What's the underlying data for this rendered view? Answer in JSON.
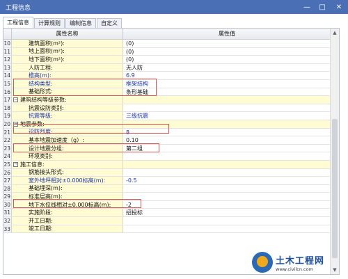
{
  "window": {
    "title": "工程信息",
    "minimize": "—",
    "maximize": "□",
    "close": "✕"
  },
  "tabs": [
    {
      "label": "工程信息"
    },
    {
      "label": "计算规则"
    },
    {
      "label": "编制信息"
    },
    {
      "label": "自定义"
    }
  ],
  "table": {
    "headers": {
      "name": "属性名称",
      "value": "属性值"
    },
    "rows": [
      {
        "num": "10",
        "name": "建筑面积(m²):",
        "value": "(0)"
      },
      {
        "num": "11",
        "name": "地上面积(m²):",
        "value": "(0)"
      },
      {
        "num": "12",
        "name": "地下面积(m²):",
        "value": "(0)"
      },
      {
        "num": "13",
        "name": "人防工程:",
        "value": "无人防"
      },
      {
        "num": "14",
        "name": "檐高(m):",
        "value": "6.9"
      },
      {
        "num": "15",
        "name": "结构类型:",
        "value": "框架结构"
      },
      {
        "num": "16",
        "name": "基础形式:",
        "value": "条形基础"
      },
      {
        "num": "17",
        "name": "建筑结构等级参数:",
        "value": ""
      },
      {
        "num": "18",
        "name": "抗震设防类别:",
        "value": ""
      },
      {
        "num": "19",
        "name": "抗震等级:",
        "value": "三级抗震"
      },
      {
        "num": "20",
        "name": "地震参数:",
        "value": ""
      },
      {
        "num": "21",
        "name": "设防烈度:",
        "value": "8"
      },
      {
        "num": "22",
        "name": "基本地震加速度（g）:",
        "value": "0.10"
      },
      {
        "num": "23",
        "name": "设计地震分组:",
        "value": "第二组"
      },
      {
        "num": "24",
        "name": "环境类别:",
        "value": ""
      },
      {
        "num": "25",
        "name": "施工信息:",
        "value": ""
      },
      {
        "num": "26",
        "name": "钢筋接头形式:",
        "value": ""
      },
      {
        "num": "27",
        "name": "室外地坪相对±0.000标高(m):",
        "value": "-0.5"
      },
      {
        "num": "28",
        "name": "基础埋深(m):",
        "value": ""
      },
      {
        "num": "29",
        "name": "标准层高(m):",
        "value": ""
      },
      {
        "num": "30",
        "name": "地下水位线相对±0.000标高(m):",
        "value": "-2"
      },
      {
        "num": "31",
        "name": "实施阶段:",
        "value": "招投标"
      },
      {
        "num": "32",
        "name": "开工日期:",
        "value": ""
      },
      {
        "num": "33",
        "name": "竣工日期:",
        "value": ""
      }
    ]
  },
  "watermark": {
    "brand": "土木工程网",
    "url": "www.civilcn.com"
  },
  "colors": {
    "titlebar": "#4b6fb5",
    "name_column": "#fffbd2",
    "highlight_box": "#d9534f"
  }
}
